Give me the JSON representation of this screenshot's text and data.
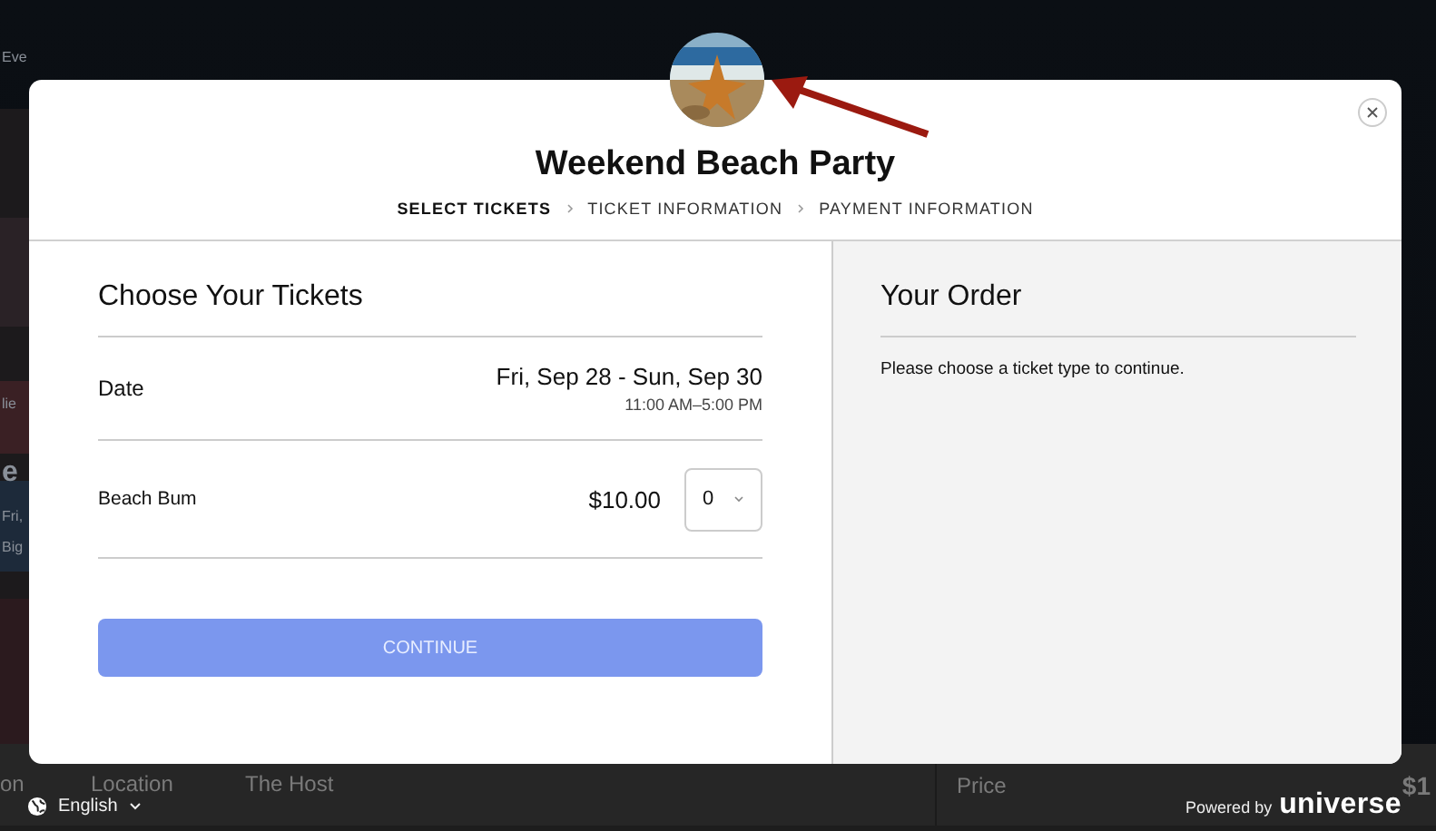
{
  "background": {
    "fragments": [
      "Eve",
      "lie",
      "e",
      "Fri,",
      "Big"
    ],
    "bottom_bar": {
      "cells": [
        "on",
        "Location",
        "The Host"
      ],
      "price_label": "Price",
      "price": "$1"
    }
  },
  "modal": {
    "title": "Weekend Beach Party",
    "steps": [
      {
        "label": "SELECT TICKETS",
        "selected": true
      },
      {
        "label": "TICKET INFORMATION",
        "selected": false
      },
      {
        "label": "PAYMENT INFORMATION",
        "selected": false
      }
    ],
    "tickets_panel": {
      "heading": "Choose Your Tickets",
      "date_label": "Date",
      "date_range": "Fri, Sep 28 - Sun, Sep 30",
      "time_range": "11:00 AM–5:00 PM",
      "tickets": [
        {
          "name": "Beach Bum",
          "price": "$10.00",
          "quantity": "0"
        }
      ],
      "continue": {
        "label": "CONTINUE",
        "disabled": true
      }
    },
    "order_panel": {
      "heading": "Your Order",
      "message": "Please choose a ticket type to continue."
    }
  },
  "language": {
    "label": "English"
  },
  "powered_by": {
    "prefix": "Powered by",
    "brand": "universe"
  }
}
